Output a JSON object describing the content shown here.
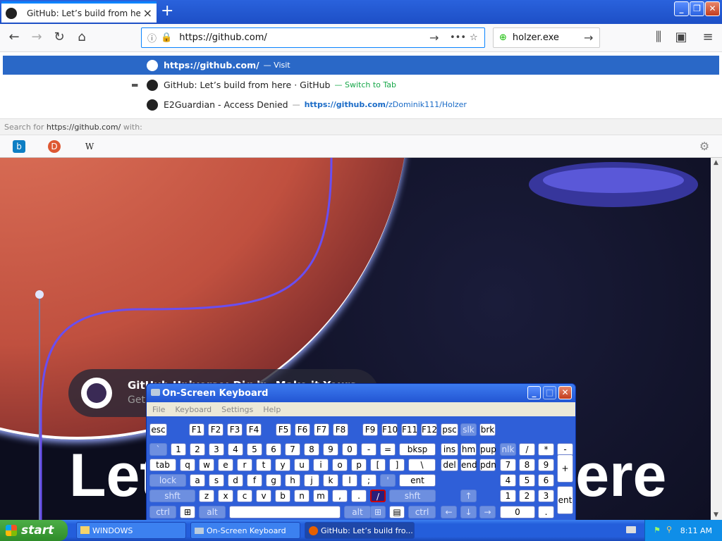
{
  "browser": {
    "tab_title": "GitHub: Let’s build from here · GitHub",
    "tab_close": "×",
    "new_tab": "+",
    "url": "https://github.com/",
    "search_value": "holzer.exe"
  },
  "dropdown": {
    "rows": [
      {
        "title": "https://github.com/",
        "sub": "— Visit"
      },
      {
        "title": "GitHub: Let’s build from here · GitHub",
        "sub": "— Switch to Tab"
      },
      {
        "title": "E2Guardian - Access Denied",
        "sub": "—",
        "link": "https://github.com/",
        "link_rest": "zDominik111/Holzer"
      }
    ],
    "search_for_prefix": "Search for ",
    "search_for_url": "https://github.com/",
    "search_for_suffix": " with:",
    "engines": [
      "b",
      "D",
      "W"
    ]
  },
  "page": {
    "card_title": "GitHub Universe: Dig in, Make it Yours",
    "card_sub": "Get",
    "headline": "Let’s build from here"
  },
  "osk": {
    "title": "On-Screen Keyboard",
    "menu": [
      "File",
      "Keyboard",
      "Settings",
      "Help"
    ]
  },
  "taskbar": {
    "start": "start",
    "tasks": [
      "WINDOWS",
      "On-Screen Keyboard",
      "GitHub: Let’s build fro..."
    ],
    "clock": "8:11 AM"
  }
}
